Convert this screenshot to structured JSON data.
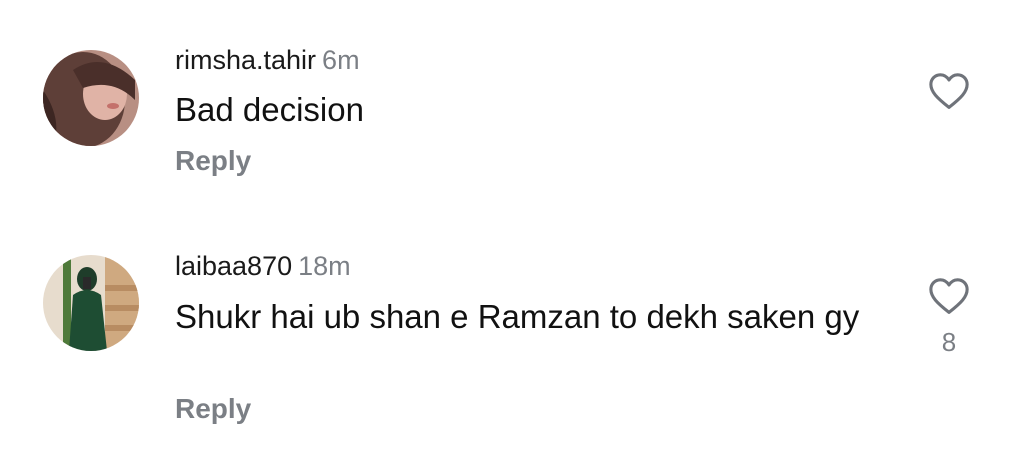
{
  "comments": [
    {
      "username": "rimsha.tahir",
      "time": "6m",
      "text": "Bad decision",
      "reply_label": "Reply",
      "like_icon": "heart-outline-icon",
      "like_count": null
    },
    {
      "username": "laibaa870",
      "time": "18m",
      "text": "Shukr hai ub shan e Ramzan to dekh saken gy",
      "reply_label": "Reply",
      "like_icon": "heart-outline-icon",
      "like_count": "8"
    }
  ],
  "colors": {
    "text": "#111111",
    "secondary": "#7b7f85",
    "icon": "#6f737a"
  }
}
